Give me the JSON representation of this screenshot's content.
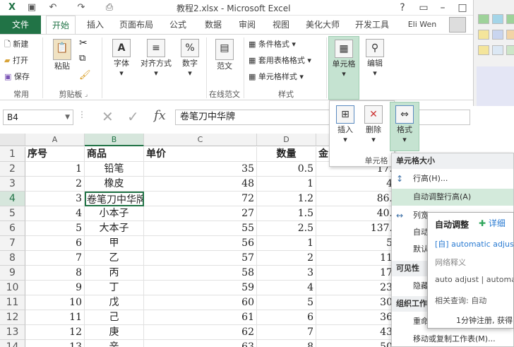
{
  "window": {
    "title": "教程2.xlsx - Microsoft Excel",
    "user": "Eli Wen"
  },
  "tabs": [
    "文件",
    "开始",
    "插入",
    "页面布局",
    "公式",
    "数据",
    "审阅",
    "视图",
    "美化大师",
    "开发工具"
  ],
  "ribbon": {
    "clipboard": {
      "new": "新建",
      "open": "打开",
      "save": "保存",
      "paste": "粘贴",
      "group": "剪贴板",
      "common": "常用"
    },
    "font": "字体",
    "align": "对齐方式",
    "number": "数字",
    "template": "范文",
    "online": "在线范文",
    "styles": {
      "cond": "条件格式",
      "table": "套用表格格式",
      "cell": "单元格样式",
      "group": "样式"
    },
    "cells": "单元格",
    "edit": "编辑"
  },
  "formula": {
    "namebox": "B4",
    "value": "卷笔刀中华牌"
  },
  "columns": [
    "A",
    "B",
    "C",
    "D",
    "E"
  ],
  "rows": [
    [
      "1",
      "序号",
      "商品",
      "单价",
      "数量",
      "金"
    ],
    [
      "2",
      "1",
      "铅笔",
      "35",
      "0.5",
      "17."
    ],
    [
      "3",
      "2",
      "橡皮",
      "48",
      "1",
      "4"
    ],
    [
      "4",
      "3",
      "卷笔刀中华牌",
      "72",
      "1.2",
      "86."
    ],
    [
      "5",
      "4",
      "小本子",
      "27",
      "1.5",
      "40."
    ],
    [
      "6",
      "5",
      "大本子",
      "55",
      "2.5",
      "137."
    ],
    [
      "7",
      "6",
      "甲",
      "56",
      "1",
      "5"
    ],
    [
      "8",
      "7",
      "乙",
      "57",
      "2",
      "11"
    ],
    [
      "9",
      "8",
      "丙",
      "58",
      "3",
      "17"
    ],
    [
      "10",
      "9",
      "丁",
      "59",
      "4",
      "23"
    ],
    [
      "11",
      "10",
      "戊",
      "60",
      "5",
      "30"
    ],
    [
      "12",
      "11",
      "己",
      "61",
      "6",
      "36"
    ],
    [
      "13",
      "12",
      "庚",
      "62",
      "7",
      "43"
    ],
    [
      "14",
      "13",
      "辛",
      "63",
      "8",
      "50"
    ]
  ],
  "celldrop": {
    "insert": "插入",
    "delete": "删除",
    "format": "格式",
    "group": "单元格"
  },
  "menu": {
    "head": "单元格大小",
    "row_height": "行高(H)...",
    "autofit": "自动调整行高(A)",
    "col_width": "列宽",
    "auto2": "自动",
    "default": "默认",
    "visibility": "可见性",
    "hide": "隐藏",
    "organize": "组织工作",
    "rename": "重命名",
    "move": "移动或复制工作表(M)..."
  },
  "tooltip": {
    "title": "自动调整",
    "detail": "详细",
    "line1": "[自] automatic adjust",
    "line2": "网络释义",
    "line3": "auto adjust | automa",
    "line4": "相关查询: 自动",
    "line5": "1分钟注册, 获得"
  }
}
